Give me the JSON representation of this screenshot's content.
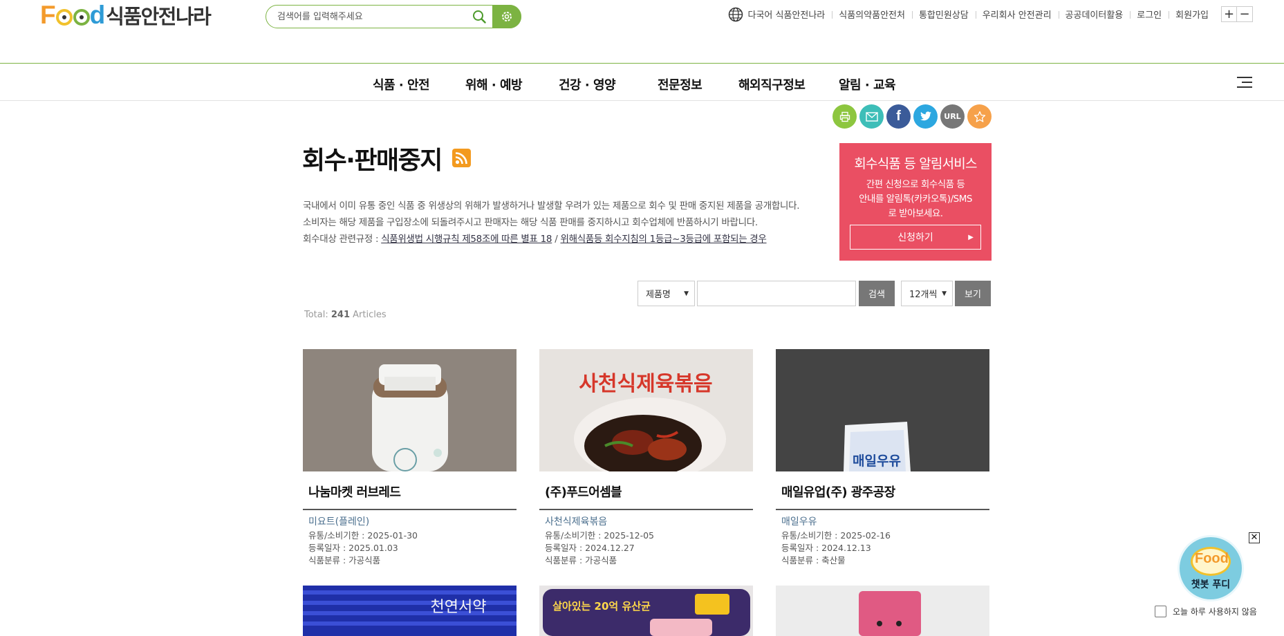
{
  "header": {
    "logo_kr": "식품안전나라",
    "search_placeholder": "검색어를 입력해주세요",
    "util_links": [
      "다국어 식품안전나라",
      "식품의약품안전처",
      "통합민원상담",
      "우리회사 안전관리",
      "공공데이터활용",
      "로그인",
      "회원가입"
    ],
    "zoom_in": "+",
    "zoom_out": "−"
  },
  "gnb": [
    "식품 · 안전",
    "위해 · 예방",
    "건강 · 영양",
    "전문정보",
    "해외직구정보",
    "알림 · 교육"
  ],
  "share": {
    "url_label": "URL"
  },
  "page": {
    "title": "회수·판매중지",
    "desc_line1": "국내에서 이미 유통 중인 식품 중 위생상의 위해가 발생하거나 발생할 우려가 있는 제품으로 회수 및 판매 중지된 제품을 공개합니다.",
    "desc_line2": "소비자는 해당 제품을 구입장소에 되돌려주시고 판매자는 해당 식품 판매를 중지하시고 회수업체에 반품하시기 바랍니다.",
    "desc_prefix": "회수대상 관련규정 : ",
    "desc_link1": "식품위생법 시행규칙 제58조에 따른 별표 18",
    "desc_sep": " / ",
    "desc_link2": "위해식품등 회수지침의 1등급~3등급에 포함되는 경우"
  },
  "alert": {
    "title": "회수식품 등 알림서비스",
    "desc_l1": "간편 신청으로 회수식품 등",
    "desc_l2": "안내를 알림톡(카카오톡)/SMS",
    "desc_l3": "로 받아보세요.",
    "button": "신청하기"
  },
  "filters": {
    "field_select": "제품명",
    "keyword_value": "",
    "search_button": "검색",
    "per_page_select": "12개씩",
    "view_button": "보기"
  },
  "total": {
    "prefix": "Total: ",
    "count": "241",
    "suffix": " Articles"
  },
  "cards": [
    {
      "company": "나눔마켓 러브레드",
      "product": "미요트(플레인)",
      "expiry": "유통/소비기한 : 2025-01-30",
      "registered": "등록일자 : 2025.01.03",
      "category": "식품분류 : 가공식품"
    },
    {
      "company": "(주)푸드어셈블",
      "product": "사천식제육볶음",
      "expiry": "유통/소비기한 : 2025-12-05",
      "registered": "등록일자 : 2024.12.27",
      "category": "식품분류 : 가공식품",
      "img_text": "사천식제육볶음"
    },
    {
      "company": "매일유업(주) 광주공장",
      "product": "매일우유",
      "expiry": "유통/소비기한 : 2025-02-16",
      "registered": "등록일자 : 2024.12.13",
      "category": "식품분류 : 축산물",
      "img_text": "매일우유"
    }
  ],
  "cards_row2": [
    {
      "img_text": "천연서약"
    },
    {
      "img_text": "살아있는 20억 유산균"
    },
    {
      "img_text": ""
    }
  ],
  "chatbot": {
    "label": "챗봇 푸디",
    "logo": "Food",
    "dismiss": "오늘 하루 사용하지 않음",
    "close": "✕"
  }
}
